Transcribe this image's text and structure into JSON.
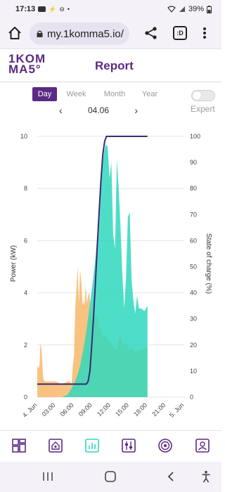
{
  "status_bar": {
    "time": "17:13",
    "battery": "39%",
    "icons": [
      "youtube-icon",
      "bolt-icon",
      "dnd-icon",
      "dot-icon",
      "wifi-icon",
      "signal-icon",
      "battery-icon"
    ]
  },
  "browser": {
    "url": "my.1komma5.io/",
    "tab_count_label": ":D",
    "icons": [
      "home-icon",
      "lock-icon",
      "share-icon",
      "tabs-icon",
      "more-vert-icon"
    ]
  },
  "app": {
    "logo_line1": "1KOM",
    "logo_line2": "MA5°",
    "title": "Report",
    "brand_color": "#5a2a84"
  },
  "period_tabs": [
    {
      "label": "Day",
      "active": true
    },
    {
      "label": "Week",
      "active": false
    },
    {
      "label": "Month",
      "active": false
    },
    {
      "label": "Year",
      "active": false
    }
  ],
  "date_nav": {
    "prev": "‹",
    "date": "04.06",
    "next": "›"
  },
  "expert": {
    "label": "Expert",
    "enabled": false
  },
  "chart_data": {
    "type": "area",
    "ylabel": "Power (kW)",
    "y2label": "State of charge (%)",
    "ylim": [
      0,
      10
    ],
    "y2lim": [
      0,
      100
    ],
    "yticks": [
      "0",
      "2",
      "4",
      "6",
      "8",
      "10"
    ],
    "y2ticks": [
      "0",
      "10",
      "20",
      "30",
      "40",
      "50",
      "60",
      "70",
      "80",
      "90",
      "100"
    ],
    "xticks": [
      "4. Jun",
      "03:00",
      "06:00",
      "09:00",
      "12:00",
      "15:00",
      "18:00",
      "21:00",
      "5. Jun"
    ],
    "xlim": [
      0,
      24
    ],
    "grid": true,
    "series": [
      {
        "color": "#f7b96a",
        "x": [
          0,
          0.2,
          0.4,
          0.5,
          0.7,
          0.9,
          1.0,
          1.2,
          1.5,
          2.0,
          3.0,
          4.0,
          5.0,
          5.3,
          5.6,
          5.8,
          6.0,
          6.2,
          6.4,
          6.6,
          6.8,
          7.0,
          7.2,
          7.4,
          7.6,
          7.7,
          7.9,
          8.1,
          8.3,
          8.5,
          8.7,
          8.9,
          9.1,
          9.3,
          9.5,
          9.7,
          9.9,
          10.1,
          10.3,
          10.5,
          10.7,
          11.0,
          11.5,
          12.0,
          12.5,
          13.0,
          13.5,
          14.0,
          14.5,
          15.0,
          15.5,
          16.0,
          16.5,
          17.0,
          17.5,
          18.0
        ],
        "values": [
          1.2,
          1.1,
          1.3,
          2.1,
          1.8,
          1.0,
          0.7,
          0.6,
          0.6,
          0.6,
          0.6,
          0.5,
          0.6,
          0.6,
          0.5,
          1.2,
          1.6,
          3.4,
          4.2,
          5.0,
          3.6,
          4.9,
          4.4,
          3.5,
          3.7,
          3.5,
          4.3,
          3.6,
          3.9,
          4.0,
          3.3,
          3.0,
          3.7,
          3.2,
          3.1,
          3.1,
          2.9,
          2.6,
          2.7,
          2.5,
          2.3,
          2.4,
          2.2,
          2.1,
          1.9,
          1.8,
          2.4,
          2.0,
          2.1,
          1.8,
          1.9,
          1.7,
          1.8,
          1.8,
          1.9,
          1.9
        ]
      },
      {
        "color": "#2fd8bd",
        "x": [
          0,
          4.0,
          5.0,
          5.5,
          6.0,
          6.5,
          7.0,
          7.5,
          8.0,
          8.5,
          9.0,
          9.5,
          10.0,
          10.3,
          10.6,
          10.9,
          11.2,
          11.5,
          11.8,
          12.1,
          12.4,
          12.7,
          13.0,
          13.3,
          13.6,
          13.9,
          14.2,
          14.5,
          14.8,
          15.1,
          15.4,
          15.7,
          16.0,
          16.3,
          16.6,
          17.0,
          17.5,
          18.0
        ],
        "values": [
          0,
          0,
          0.1,
          0.3,
          0.5,
          0.8,
          1.2,
          1.8,
          2.5,
          3.4,
          4.3,
          5.3,
          6.8,
          8.0,
          8.8,
          9.4,
          9.7,
          9.6,
          8.4,
          9.0,
          6.2,
          5.7,
          9.1,
          8.0,
          6.5,
          4.7,
          3.4,
          4.6,
          6.9,
          7.1,
          4.5,
          3.7,
          3.2,
          3.9,
          3.4,
          3.4,
          3.3,
          3.5
        ]
      },
      {
        "color": "#3c2a78",
        "axis": "right",
        "x": [
          0,
          7.5,
          8.0,
          8.3,
          8.6,
          8.9,
          9.2,
          9.5,
          9.8,
          10.1,
          10.4,
          10.7,
          11.0,
          11.3,
          11.6,
          12.0,
          18.0
        ],
        "values": [
          5,
          5,
          5,
          6,
          10,
          20,
          31,
          44,
          58,
          71,
          83,
          93,
          98,
          100,
          100,
          100,
          100
        ]
      }
    ]
  },
  "bottom_nav": [
    {
      "icon": "dashboard-icon",
      "active": false
    },
    {
      "icon": "house-icon",
      "active": false
    },
    {
      "icon": "report-chart-icon",
      "active": true
    },
    {
      "icon": "sliders-icon",
      "active": false
    },
    {
      "icon": "target-icon",
      "active": false
    },
    {
      "icon": "profile-icon",
      "active": false
    }
  ],
  "system_nav": {
    "icons": [
      "recents-icon",
      "home-circle-icon",
      "back-icon",
      "accessibility-icon"
    ]
  }
}
